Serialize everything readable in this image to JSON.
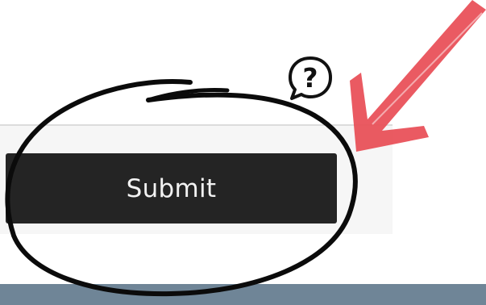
{
  "form": {
    "submit_label": "Submit"
  },
  "icons": {
    "help": "help-question-bubble-icon"
  },
  "annotations": {
    "arrow_color": "#e9525a",
    "circle_color": "#0b0b0b"
  },
  "colors": {
    "button_bg": "#242424",
    "button_text": "#f2f2f2",
    "panel_bg": "#f6f6f6",
    "footer_bg": "#6f8597"
  }
}
